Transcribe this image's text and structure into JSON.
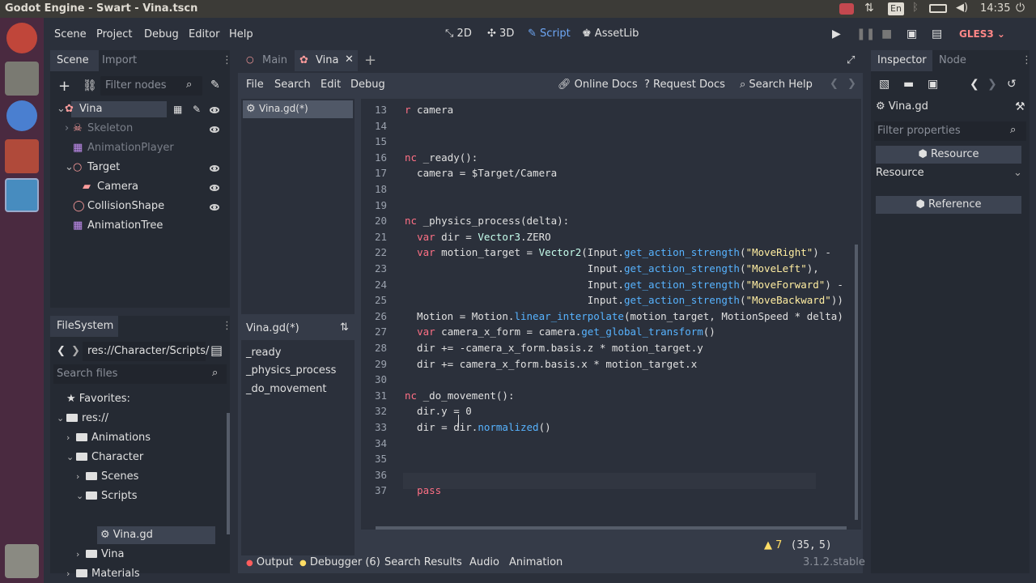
{
  "os_bar": {
    "title": "Godot Engine - Swart - Vina.tscn",
    "lang": "En",
    "time": "14:35"
  },
  "menu": [
    "Scene",
    "Project",
    "Debug",
    "Editor",
    "Help"
  ],
  "workspaces": [
    {
      "icon": "2d-icon",
      "label": "2D"
    },
    {
      "icon": "3d-icon",
      "label": "3D"
    },
    {
      "icon": "script-icon",
      "label": "Script"
    },
    {
      "icon": "assetlib-icon",
      "label": "AssetLib"
    }
  ],
  "renderer": "GLES3",
  "scene_dock": {
    "tabs": [
      "Scene",
      "Import"
    ],
    "filter_placeholder": "Filter nodes",
    "nodes": [
      {
        "label": "Vina",
        "icon": "kinematic-body-icon"
      },
      {
        "label": "Skeleton",
        "icon": "skeleton-icon"
      },
      {
        "label": "AnimationPlayer",
        "icon": "animation-player-icon"
      },
      {
        "label": "Target",
        "icon": "spatial-icon"
      },
      {
        "label": "Camera",
        "icon": "camera-icon"
      },
      {
        "label": "CollisionShape",
        "icon": "collision-shape-icon"
      },
      {
        "label": "AnimationTree",
        "icon": "animation-tree-icon"
      }
    ]
  },
  "filesystem": {
    "tab": "FileSystem",
    "path": "res://Character/Scripts/",
    "search_placeholder": "Search files",
    "items": [
      "Favorites:",
      "res://",
      "Animations",
      "Character",
      "Scenes",
      "Scripts",
      "Vina.gd",
      "Vina",
      "Materials"
    ]
  },
  "scene_tabs": [
    "Main",
    "Vina"
  ],
  "script_menu": [
    "File",
    "Search",
    "Edit",
    "Debug"
  ],
  "doc_buttons": [
    "Online Docs",
    "Request Docs",
    "Search Help"
  ],
  "script_list": {
    "open": "Vina.gd(*)",
    "current": "Vina.gd(*)",
    "methods": [
      "_ready",
      "_physics_process",
      "_do_movement"
    ]
  },
  "code": [
    {
      "n": "13",
      "text": "r camera"
    },
    {
      "n": "14",
      "text": ""
    },
    {
      "n": "15",
      "text": ""
    },
    {
      "n": "16",
      "text": "nc _ready():"
    },
    {
      "n": "17",
      "text": "  camera = $Target/Camera"
    },
    {
      "n": "18",
      "text": ""
    },
    {
      "n": "19",
      "text": ""
    },
    {
      "n": "20",
      "text": "nc _physics_process(delta):"
    },
    {
      "n": "21",
      "text": "  var dir = Vector3.ZERO"
    },
    {
      "n": "22",
      "text": "  var motion_target = Vector2(Input.get_action_strength(\"MoveRight\") -"
    },
    {
      "n": "23",
      "text": "                              Input.get_action_strength(\"MoveLeft\"),"
    },
    {
      "n": "24",
      "text": "                              Input.get_action_strength(\"MoveForward\") -"
    },
    {
      "n": "25",
      "text": "                              Input.get_action_strength(\"MoveBackward\"))"
    },
    {
      "n": "26",
      "text": "  Motion = Motion.linear_interpolate(motion_target, MotionSpeed * delta)"
    },
    {
      "n": "27",
      "text": "  var camera_x_form = camera.get_global_transform()"
    },
    {
      "n": "28",
      "text": "  dir += -camera_x_form.basis.z * motion_target.y"
    },
    {
      "n": "29",
      "text": "  dir += camera_x_form.basis.x * motion_target.x"
    },
    {
      "n": "30",
      "text": ""
    },
    {
      "n": "31",
      "text": "nc _do_movement():"
    },
    {
      "n": "32",
      "text": "  dir.y = 0"
    },
    {
      "n": "33",
      "text": "  dir = dir.normalized()"
    },
    {
      "n": "34",
      "text": ""
    },
    {
      "n": "35",
      "text": ""
    },
    {
      "n": "36",
      "text": ""
    },
    {
      "n": "37",
      "text": "  pass"
    }
  ],
  "status": {
    "warnings": "7",
    "line": "35",
    "col": "5"
  },
  "bottom_tabs": [
    "Output",
    "Debugger (6)",
    "Search Results",
    "Audio",
    "Animation"
  ],
  "version": "3.1.2.stable",
  "inspector": {
    "tabs": [
      "Inspector",
      "Node"
    ],
    "file": "Vina.gd",
    "filter_placeholder": "Filter properties",
    "resource_header": "Resource",
    "resource_label": "Resource",
    "reference_header": "Reference"
  }
}
